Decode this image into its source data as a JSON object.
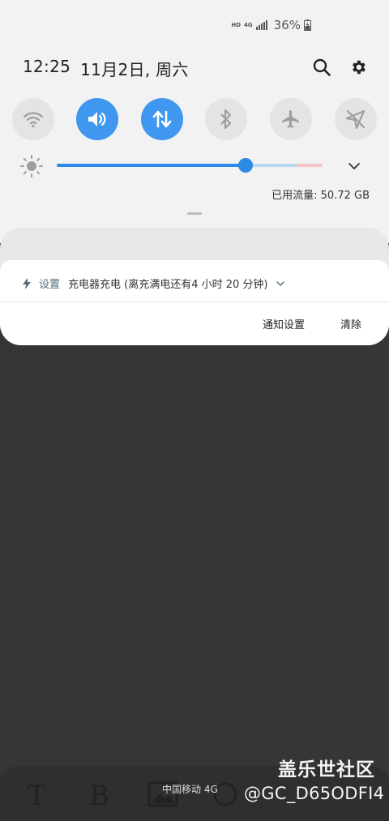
{
  "status_bar": {
    "hd_label": "HD",
    "network_label": "4G",
    "battery_percent": "36%",
    "icons": [
      "hd-icon",
      "4g-icon",
      "signal-icon",
      "battery-charging-icon"
    ]
  },
  "header": {
    "time": "12:25",
    "date": "11月2日, 周六",
    "search_icon": "search-icon",
    "settings_icon": "gear-icon"
  },
  "quick_toggles": [
    {
      "name": "wifi",
      "icon": "wifi-icon",
      "active": false
    },
    {
      "name": "sound",
      "icon": "sound-icon",
      "active": true
    },
    {
      "name": "mobile-data",
      "icon": "mobile-data-icon",
      "active": true
    },
    {
      "name": "bluetooth",
      "icon": "bluetooth-icon",
      "active": false
    },
    {
      "name": "airplane-mode",
      "icon": "airplane-icon",
      "active": false
    },
    {
      "name": "location",
      "icon": "location-off-icon",
      "active": false
    }
  ],
  "brightness": {
    "level": 0.71,
    "icon": "brightness-icon"
  },
  "data_usage": "已用流量: 50.72 GB",
  "notification": {
    "app_name": "设置",
    "text": "充电器充电 (离充满电还有4 小时 20 分钟)",
    "actions": {
      "settings": "通知设置",
      "clear": "清除"
    }
  },
  "carrier": "中国移动 4G",
  "watermark": {
    "title": "盖乐世社区",
    "user": "@GC_D65ODFI4"
  },
  "background_toolbar": [
    "T",
    "B"
  ],
  "colors": {
    "accent": "#3f97f0",
    "panel_bg": "#f2f2f2",
    "dim_bg": "#363636"
  }
}
